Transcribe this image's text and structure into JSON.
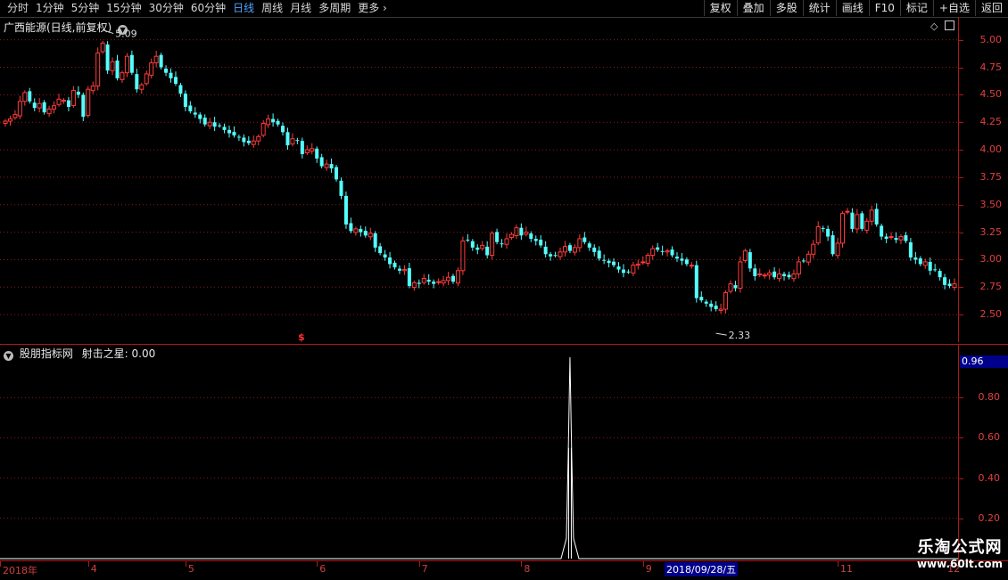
{
  "toolbar": {
    "periods": [
      "分时",
      "1分钟",
      "5分钟",
      "15分钟",
      "30分钟",
      "60分钟",
      "日线",
      "周线",
      "月线",
      "多周期",
      "更多"
    ],
    "active_period": "日线",
    "buttons": [
      "复权",
      "叠加",
      "多股",
      "统计",
      "画线",
      "F10",
      "标记",
      "+自选",
      "返回"
    ]
  },
  "main_panel": {
    "title": "广西能源(日线,前复权)",
    "high_marker": "5.09",
    "low_marker": "2.33",
    "y_ticks": [
      "5.00",
      "4.75",
      "4.50",
      "4.25",
      "4.00",
      "3.75",
      "3.50",
      "3.25",
      "3.00",
      "2.75",
      "2.50"
    ],
    "dividend_marker": "$"
  },
  "sub_panel": {
    "title": "股朋指标网",
    "indicator_name": "射击之星:",
    "indicator_value": "0.00",
    "current_value": "0.96",
    "y_ticks": [
      "0.80",
      "0.60",
      "0.40",
      "0.20"
    ]
  },
  "date_axis": {
    "labels": [
      "2018年",
      "4",
      "5",
      "6",
      "7",
      "8",
      "9",
      "11",
      "12"
    ],
    "cursor_date": "2018/09/28/五"
  },
  "watermark": {
    "title": "乐淘公式网",
    "url": "www.60lt.com"
  },
  "colors": {
    "up": "#ff3b3b",
    "down": "#54ffff",
    "axis": "#b01818",
    "grid": "#8a1a1a"
  },
  "chart_data": [
    {
      "type": "candlestick",
      "title": "广西能源(日线,前复权)",
      "ylim": [
        2.25,
        5.2
      ],
      "y_ticks": [
        5.0,
        4.75,
        4.5,
        4.25,
        4.0,
        3.75,
        3.5,
        3.25,
        3.0,
        2.75,
        2.5
      ],
      "max_label": 5.09,
      "min_label": 2.33,
      "close": [
        4.26,
        4.28,
        4.32,
        4.44,
        4.52,
        4.44,
        4.38,
        4.42,
        4.34,
        4.37,
        4.4,
        4.46,
        4.45,
        4.39,
        4.54,
        4.5,
        4.3,
        4.55,
        4.58,
        4.88,
        4.97,
        4.72,
        4.8,
        4.65,
        4.7,
        4.85,
        4.7,
        4.55,
        4.59,
        4.69,
        4.79,
        4.85,
        4.75,
        4.7,
        4.65,
        4.6,
        4.51,
        4.39,
        4.35,
        4.32,
        4.28,
        4.23,
        4.25,
        4.21,
        4.22,
        4.18,
        4.15,
        4.13,
        4.11,
        4.07,
        4.06,
        4.08,
        4.12,
        4.24,
        4.28,
        4.25,
        4.23,
        4.16,
        4.04,
        4.1,
        4.08,
        3.96,
        4.0,
        4.01,
        3.92,
        3.85,
        3.87,
        3.83,
        3.73,
        3.58,
        3.32,
        3.26,
        3.28,
        3.25,
        3.22,
        3.24,
        3.11,
        3.06,
        3.02,
        2.96,
        2.93,
        2.9,
        2.91,
        2.76,
        2.79,
        2.78,
        2.83,
        2.8,
        2.78,
        2.8,
        2.81,
        2.84,
        2.8,
        2.9,
        3.17,
        3.18,
        3.11,
        3.09,
        3.13,
        3.04,
        3.24,
        3.16,
        3.14,
        3.19,
        3.23,
        3.29,
        3.22,
        3.25,
        3.19,
        3.17,
        3.13,
        3.05,
        3.03,
        3.04,
        3.07,
        3.12,
        3.08,
        3.11,
        3.19,
        3.16,
        3.11,
        3.07,
        3.01,
        2.99,
        2.97,
        2.95,
        2.91,
        2.88,
        2.89,
        2.95,
        2.96,
        2.98,
        3.04,
        3.1,
        3.09,
        3.07,
        3.08,
        3.04,
        3.01,
        2.99,
        2.96,
        2.95,
        2.65,
        2.63,
        2.6,
        2.57,
        2.55,
        2.55,
        2.7,
        2.78,
        2.74,
        2.98,
        3.08,
        2.92,
        2.85,
        2.87,
        2.86,
        2.88,
        2.84,
        2.87,
        2.85,
        2.84,
        2.87,
        2.98,
        2.99,
        3.05,
        3.14,
        3.3,
        3.28,
        3.21,
        3.05,
        3.15,
        3.42,
        3.44,
        3.28,
        3.41,
        3.28,
        3.35,
        3.45,
        3.32,
        3.21,
        3.19,
        3.21,
        3.18,
        3.21,
        3.17,
        3.02,
        3.0,
        2.96,
        2.98,
        2.9,
        2.91,
        2.84,
        2.77,
        2.76,
        2.78
      ],
      "note": "close prices per trading day, read approximately from the chart"
    },
    {
      "type": "line",
      "title": "射击之星",
      "ylim": [
        0,
        1.0
      ],
      "y_ticks": [
        0.8,
        0.6,
        0.4,
        0.2
      ],
      "current_value": 0.96,
      "spike_index": 116,
      "spike_value": 1.0
    }
  ]
}
